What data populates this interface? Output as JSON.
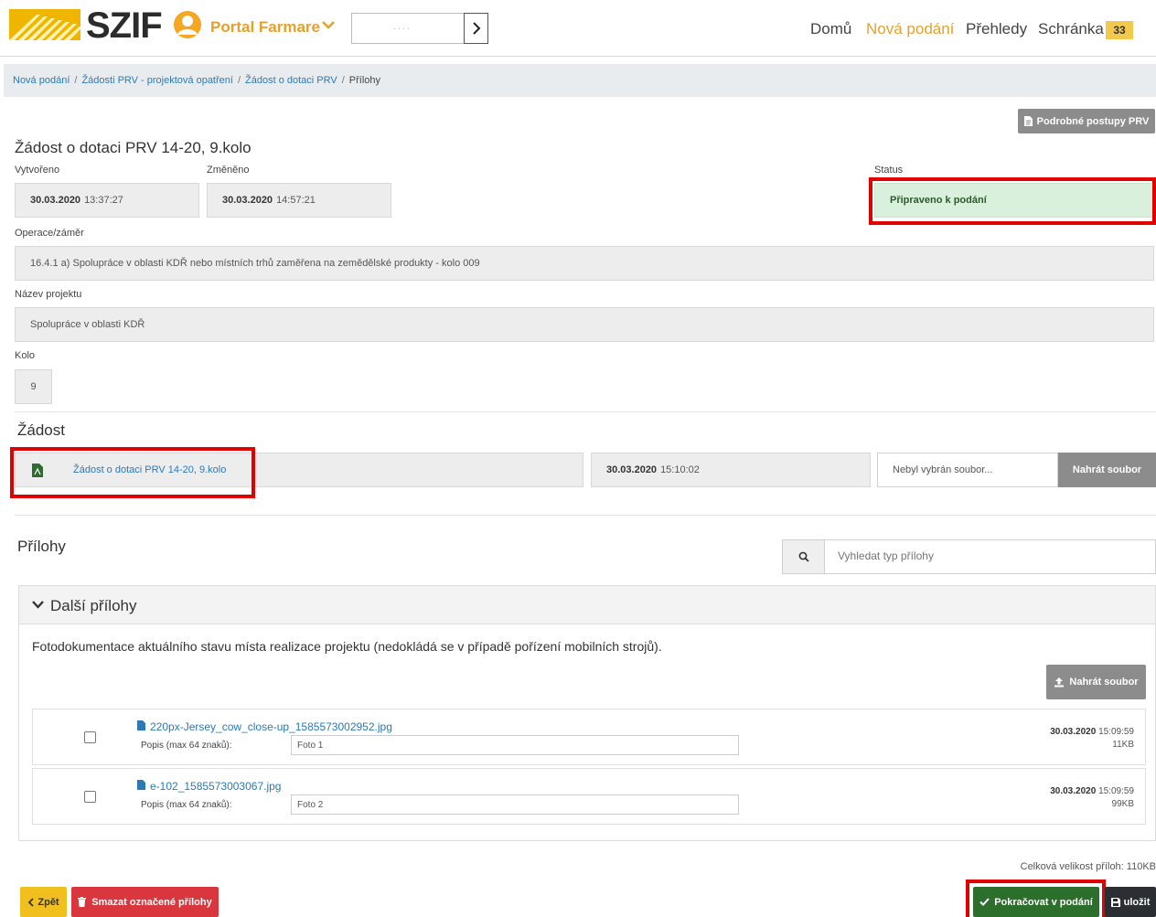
{
  "header": {
    "logo": "SZIF",
    "portal": "Portal Farmare",
    "search_dots": ". . . .",
    "nav": [
      "Domů",
      "Nová podání",
      "Přehledy",
      "Schránka"
    ],
    "inbox_count": "33",
    "colors": {
      "accent": "#e8a02a",
      "badge": "#f2c94c"
    }
  },
  "breadcrumb": [
    "Nová podání",
    "Žádosti PRV - projektová opatření",
    "Žádost o dotaci PRV",
    "Přílohy"
  ],
  "procedures_button": "Podrobné postupy PRV",
  "form": {
    "title": "Žádost o dotaci PRV 14-20, 9.kolo",
    "created_label": "Vytvořeno",
    "created_date": "30.03.2020",
    "created_time": "13:37:27",
    "changed_label": "Změněno",
    "changed_date": "30.03.2020",
    "changed_time": "14:57:21",
    "status_label": "Status",
    "status_value": "Připraveno k podání",
    "operation_label": "Operace/záměr",
    "operation_value": "16.4.1 a) Spolupráce v oblasti KDŘ nebo místních trhů zaměřena na zemědělské produkty - kolo 009",
    "project_label": "Název projektu",
    "project_value": "Spolupráce v oblasti KDŘ",
    "round_label": "Kolo",
    "round_value": "9"
  },
  "request": {
    "heading": "Žádost",
    "file_name": "Žádost o dotaci PRV 14-20, 9.kolo",
    "date": "30.03.2020",
    "time": "15:10:02",
    "upload_placeholder": "Nebyl vybrán soubor...",
    "upload_button": "Nahrát soubor"
  },
  "attachments": {
    "heading": "Přílohy",
    "search_placeholder": "Vyhledat typ přílohy",
    "group_title": "Další přílohy",
    "group_description": "Fotodokumentace aktuálního stavu místa realizace projektu (nedokládá se v případě pořízení mobilních strojů).",
    "upload_button": "Nahrát soubor",
    "desc_label": "Popis (max 64 znaků):",
    "files": [
      {
        "name": "220px-Jersey_cow_close-up_1585573002952.jpg",
        "description": "Foto 1",
        "date": "30.03.2020",
        "time": "15:09:59",
        "size": "11KB"
      },
      {
        "name": "e-102_1585573003067.jpg",
        "description": "Foto 2",
        "date": "30.03.2020",
        "time": "15:09:59",
        "size": "99KB"
      }
    ],
    "total_size": "Celková velikost příloh: 110KB"
  },
  "footer": {
    "back": "Zpět",
    "delete": "Smazat označené přílohy",
    "continue": "Pokračovat v podání",
    "save": "uložit"
  }
}
